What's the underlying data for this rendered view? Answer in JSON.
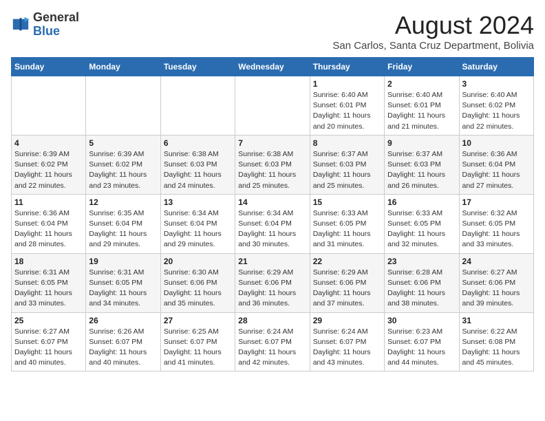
{
  "header": {
    "logo_general": "General",
    "logo_blue": "Blue",
    "month_year": "August 2024",
    "location": "San Carlos, Santa Cruz Department, Bolivia"
  },
  "calendar": {
    "days_of_week": [
      "Sunday",
      "Monday",
      "Tuesday",
      "Wednesday",
      "Thursday",
      "Friday",
      "Saturday"
    ],
    "weeks": [
      [
        {
          "day": "",
          "info": ""
        },
        {
          "day": "",
          "info": ""
        },
        {
          "day": "",
          "info": ""
        },
        {
          "day": "",
          "info": ""
        },
        {
          "day": "1",
          "info": "Sunrise: 6:40 AM\nSunset: 6:01 PM\nDaylight: 11 hours\nand 20 minutes."
        },
        {
          "day": "2",
          "info": "Sunrise: 6:40 AM\nSunset: 6:01 PM\nDaylight: 11 hours\nand 21 minutes."
        },
        {
          "day": "3",
          "info": "Sunrise: 6:40 AM\nSunset: 6:02 PM\nDaylight: 11 hours\nand 22 minutes."
        }
      ],
      [
        {
          "day": "4",
          "info": "Sunrise: 6:39 AM\nSunset: 6:02 PM\nDaylight: 11 hours\nand 22 minutes."
        },
        {
          "day": "5",
          "info": "Sunrise: 6:39 AM\nSunset: 6:02 PM\nDaylight: 11 hours\nand 23 minutes."
        },
        {
          "day": "6",
          "info": "Sunrise: 6:38 AM\nSunset: 6:03 PM\nDaylight: 11 hours\nand 24 minutes."
        },
        {
          "day": "7",
          "info": "Sunrise: 6:38 AM\nSunset: 6:03 PM\nDaylight: 11 hours\nand 25 minutes."
        },
        {
          "day": "8",
          "info": "Sunrise: 6:37 AM\nSunset: 6:03 PM\nDaylight: 11 hours\nand 25 minutes."
        },
        {
          "day": "9",
          "info": "Sunrise: 6:37 AM\nSunset: 6:03 PM\nDaylight: 11 hours\nand 26 minutes."
        },
        {
          "day": "10",
          "info": "Sunrise: 6:36 AM\nSunset: 6:04 PM\nDaylight: 11 hours\nand 27 minutes."
        }
      ],
      [
        {
          "day": "11",
          "info": "Sunrise: 6:36 AM\nSunset: 6:04 PM\nDaylight: 11 hours\nand 28 minutes."
        },
        {
          "day": "12",
          "info": "Sunrise: 6:35 AM\nSunset: 6:04 PM\nDaylight: 11 hours\nand 29 minutes."
        },
        {
          "day": "13",
          "info": "Sunrise: 6:34 AM\nSunset: 6:04 PM\nDaylight: 11 hours\nand 29 minutes."
        },
        {
          "day": "14",
          "info": "Sunrise: 6:34 AM\nSunset: 6:04 PM\nDaylight: 11 hours\nand 30 minutes."
        },
        {
          "day": "15",
          "info": "Sunrise: 6:33 AM\nSunset: 6:05 PM\nDaylight: 11 hours\nand 31 minutes."
        },
        {
          "day": "16",
          "info": "Sunrise: 6:33 AM\nSunset: 6:05 PM\nDaylight: 11 hours\nand 32 minutes."
        },
        {
          "day": "17",
          "info": "Sunrise: 6:32 AM\nSunset: 6:05 PM\nDaylight: 11 hours\nand 33 minutes."
        }
      ],
      [
        {
          "day": "18",
          "info": "Sunrise: 6:31 AM\nSunset: 6:05 PM\nDaylight: 11 hours\nand 33 minutes."
        },
        {
          "day": "19",
          "info": "Sunrise: 6:31 AM\nSunset: 6:05 PM\nDaylight: 11 hours\nand 34 minutes."
        },
        {
          "day": "20",
          "info": "Sunrise: 6:30 AM\nSunset: 6:06 PM\nDaylight: 11 hours\nand 35 minutes."
        },
        {
          "day": "21",
          "info": "Sunrise: 6:29 AM\nSunset: 6:06 PM\nDaylight: 11 hours\nand 36 minutes."
        },
        {
          "day": "22",
          "info": "Sunrise: 6:29 AM\nSunset: 6:06 PM\nDaylight: 11 hours\nand 37 minutes."
        },
        {
          "day": "23",
          "info": "Sunrise: 6:28 AM\nSunset: 6:06 PM\nDaylight: 11 hours\nand 38 minutes."
        },
        {
          "day": "24",
          "info": "Sunrise: 6:27 AM\nSunset: 6:06 PM\nDaylight: 11 hours\nand 39 minutes."
        }
      ],
      [
        {
          "day": "25",
          "info": "Sunrise: 6:27 AM\nSunset: 6:07 PM\nDaylight: 11 hours\nand 40 minutes."
        },
        {
          "day": "26",
          "info": "Sunrise: 6:26 AM\nSunset: 6:07 PM\nDaylight: 11 hours\nand 40 minutes."
        },
        {
          "day": "27",
          "info": "Sunrise: 6:25 AM\nSunset: 6:07 PM\nDaylight: 11 hours\nand 41 minutes."
        },
        {
          "day": "28",
          "info": "Sunrise: 6:24 AM\nSunset: 6:07 PM\nDaylight: 11 hours\nand 42 minutes."
        },
        {
          "day": "29",
          "info": "Sunrise: 6:24 AM\nSunset: 6:07 PM\nDaylight: 11 hours\nand 43 minutes."
        },
        {
          "day": "30",
          "info": "Sunrise: 6:23 AM\nSunset: 6:07 PM\nDaylight: 11 hours\nand 44 minutes."
        },
        {
          "day": "31",
          "info": "Sunrise: 6:22 AM\nSunset: 6:08 PM\nDaylight: 11 hours\nand 45 minutes."
        }
      ]
    ]
  }
}
